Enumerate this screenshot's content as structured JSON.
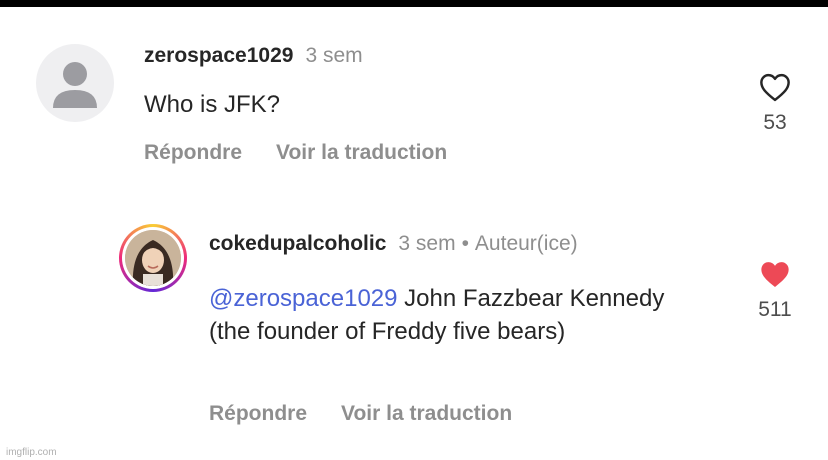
{
  "comments": [
    {
      "username": "zerospace1029",
      "time": "3 sem",
      "text": "Who is JFK?",
      "reply_label": "Répondre",
      "translate_label": "Voir la traduction",
      "likes": "53",
      "liked": false
    },
    {
      "username": "cokedupalcoholic",
      "time": "3 sem",
      "separator": "•",
      "author_badge": "Auteur(ice)",
      "mention": "@zerospace1029",
      "text": " John Fazzbear Kennedy (the founder of Freddy five bears)",
      "reply_label": "Répondre",
      "translate_label": "Voir la traduction",
      "likes": "511",
      "liked": true
    }
  ],
  "colors": {
    "like_active": "#ed4956",
    "mention": "#4a63d6",
    "muted": "#8e8e8e"
  },
  "icons": {
    "default_avatar": "person-silhouette-icon",
    "like_outline": "heart-outline-icon",
    "like_filled": "heart-filled-icon"
  },
  "watermark": "imgflip.com"
}
